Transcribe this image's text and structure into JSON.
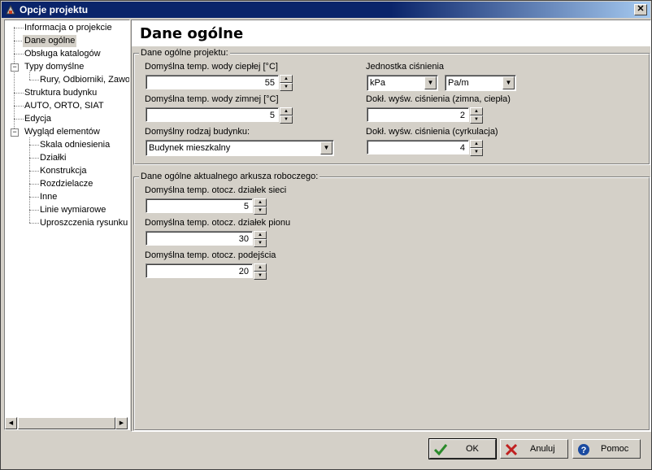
{
  "window": {
    "title": "Opcje projektu",
    "close_glyph": "✕"
  },
  "tree": {
    "items": [
      {
        "label": "Informacja o projekcie"
      },
      {
        "label": "Dane ogólne",
        "selected": true
      },
      {
        "label": "Obsługa katalogów"
      },
      {
        "label": "Typy domyślne",
        "expanded": true
      },
      {
        "label": "Rury, Odbiorniki, Zawory"
      },
      {
        "label": "Struktura budynku"
      },
      {
        "label": "AUTO, ORTO, SIAT"
      },
      {
        "label": "Edycja"
      },
      {
        "label": "Wygląd elementów",
        "expanded": true
      },
      {
        "label": "Skala odniesienia"
      },
      {
        "label": "Działki"
      },
      {
        "label": "Konstrukcja"
      },
      {
        "label": "Rozdzielacze"
      },
      {
        "label": "Inne"
      },
      {
        "label": "Linie wymiarowe"
      },
      {
        "label": "Uproszczenia rysunku"
      }
    ],
    "expander_glyph": "−"
  },
  "page": {
    "title": "Dane ogólne"
  },
  "project_group": {
    "title": "Dane ogólne projektu:",
    "hot_water_label": "Domyślna temp. wody ciepłej [°C]",
    "hot_water_value": "55",
    "cold_water_label": "Domyślna temp. wody zimnej [°C]",
    "cold_water_value": "5",
    "building_type_label": "Domyślny rodzaj budynku:",
    "building_type_value": "Budynek mieszkalny",
    "pressure_unit_label": "Jednostka ciśnienia",
    "pressure_unit_value": "kPa",
    "pressure_unit2_value": "Pa/m",
    "pressure_precision_label": "Dokł. wyśw. ciśnienia (zimna, ciepła)",
    "pressure_precision_value": "2",
    "pressure_circ_label": "Dokł. wyśw. ciśnienia (cyrkulacja)",
    "pressure_circ_value": "4"
  },
  "sheet_group": {
    "title": "Dane ogólne aktualnego arkusza roboczego:",
    "network_temp_label": "Domyślna temp. otocz. działek sieci",
    "network_temp_value": "5",
    "riser_temp_label": "Domyślna temp. otocz. działek pionu",
    "riser_temp_value": "30",
    "branch_temp_label": "Domyślna temp. otocz. podejścia",
    "branch_temp_value": "20"
  },
  "buttons": {
    "ok": "OK",
    "cancel": "Anuluj",
    "help": "Pomoc"
  },
  "glyphs": {
    "up": "▲",
    "down": "▼",
    "left": "◀",
    "right": "▶"
  },
  "icons": {
    "ok": "check-icon",
    "cancel": "x-icon",
    "help": "help-icon"
  },
  "colors": {
    "title_bar": "#0a246a",
    "ok_icon": "#2a8a2a",
    "cancel_icon": "#c02020",
    "help_icon": "#1a4aa0"
  }
}
